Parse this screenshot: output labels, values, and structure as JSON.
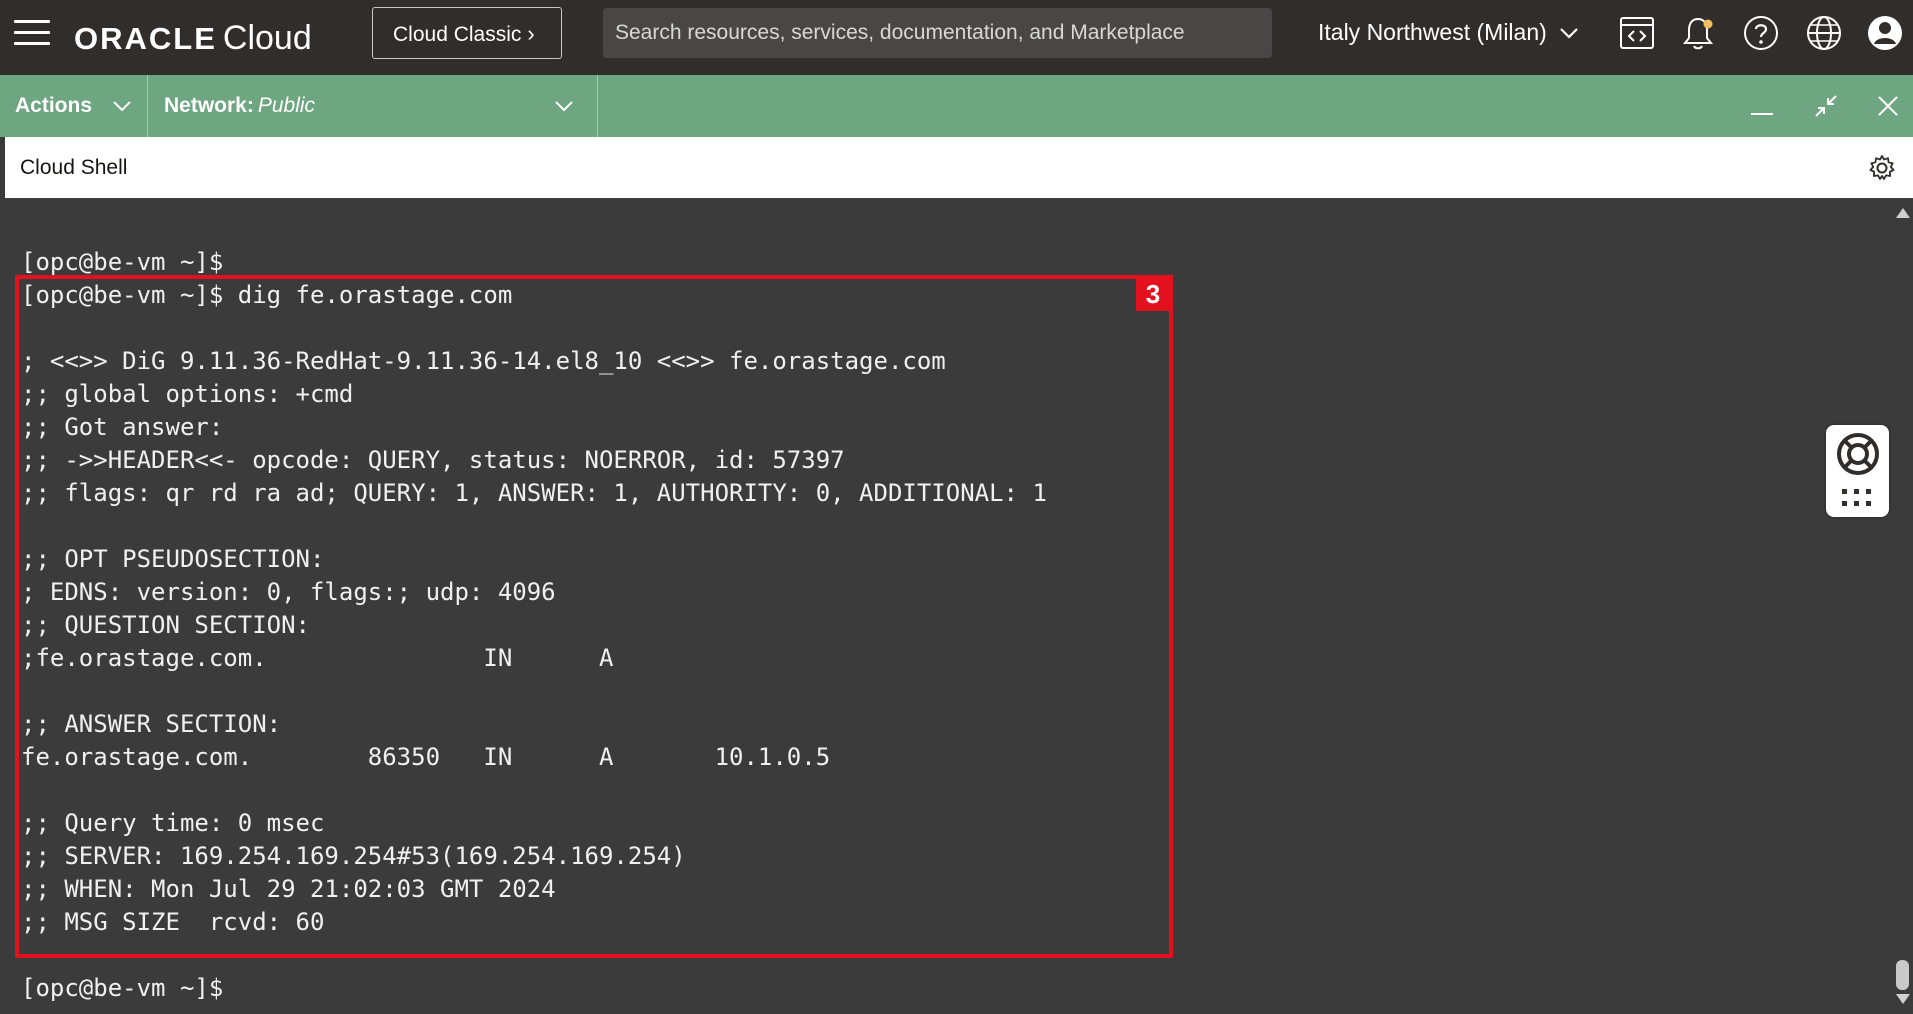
{
  "topbar": {
    "menu_icon": "hamburger-menu-icon",
    "brand_oracle": "ORACLE",
    "brand_cloud": "Cloud",
    "classic_button": "Cloud Classic",
    "search_placeholder": "Search resources, services, documentation, and Marketplace",
    "region": "Italy Northwest (Milan)",
    "icons": [
      "code-editor-icon",
      "bell-icon",
      "help-icon",
      "globe-icon",
      "user-profile-icon"
    ]
  },
  "actionbar": {
    "actions_label": "Actions",
    "network_label": "Network:",
    "network_value": "Public",
    "icons": [
      "minimize-icon",
      "restore-icon",
      "close-icon"
    ]
  },
  "shell": {
    "title": "Cloud Shell",
    "settings_icon": "gear-icon"
  },
  "terminal": {
    "lines": [
      "[opc@be-vm ~]$",
      "[opc@be-vm ~]$ dig fe.orastage.com",
      "",
      "; <<>> DiG 9.11.36-RedHat-9.11.36-14.el8_10 <<>> fe.orastage.com",
      ";; global options: +cmd",
      ";; Got answer:",
      ";; ->>HEADER<<- opcode: QUERY, status: NOERROR, id: 57397",
      ";; flags: qr rd ra ad; QUERY: 1, ANSWER: 1, AUTHORITY: 0, ADDITIONAL: 1",
      "",
      ";; OPT PSEUDOSECTION:",
      "; EDNS: version: 0, flags:; udp: 4096",
      ";; QUESTION SECTION:",
      ";fe.orastage.com.               IN      A",
      "",
      ";; ANSWER SECTION:",
      "fe.orastage.com.        86350   IN      A       10.1.0.5",
      "",
      ";; Query time: 0 msec",
      ";; SERVER: 169.254.169.254#53(169.254.169.254)",
      ";; WHEN: Mon Jul 29 21:02:03 GMT 2024",
      ";; MSG SIZE  rcvd: 60",
      "",
      "[opc@be-vm ~]$"
    ],
    "annotation_badge": "3"
  },
  "help_widget": {
    "icons": [
      "lifebuoy-icon",
      "apps-grid-icon"
    ]
  }
}
